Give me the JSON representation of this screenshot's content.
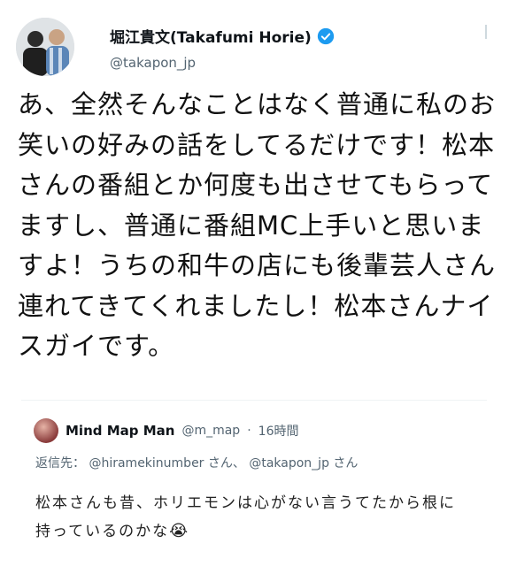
{
  "tweet": {
    "author": {
      "display_name": "堀江貴文(Takafumi Horie)",
      "handle": "@takapon_jp",
      "verified": true
    },
    "body": "あ、全然そんなことはなく普通に私のお笑いの好みの話をしてるだけです！松本さんの番組とか何度も出させてもらってますし、普通に番組MC上手いと思いますよ！うちの和牛の店にも後輩芸人さん連れてきてくれましたし！松本さんナイスガイです。"
  },
  "quoted": {
    "author": {
      "display_name": "Mind Map Man",
      "handle": "@m_map",
      "time": "16時間"
    },
    "replying_to_label": "返信先：",
    "replying_to": [
      "@hiramekinumber さん、",
      "@takapon_jp さん"
    ],
    "text": "松本さんも昔、ホリエモンは心がない言うてたから根に持っているのかな",
    "emoji": "😭"
  },
  "colors": {
    "verified_blue": "#1d9bf0",
    "text_primary": "#0f1419",
    "text_secondary": "#536471"
  }
}
